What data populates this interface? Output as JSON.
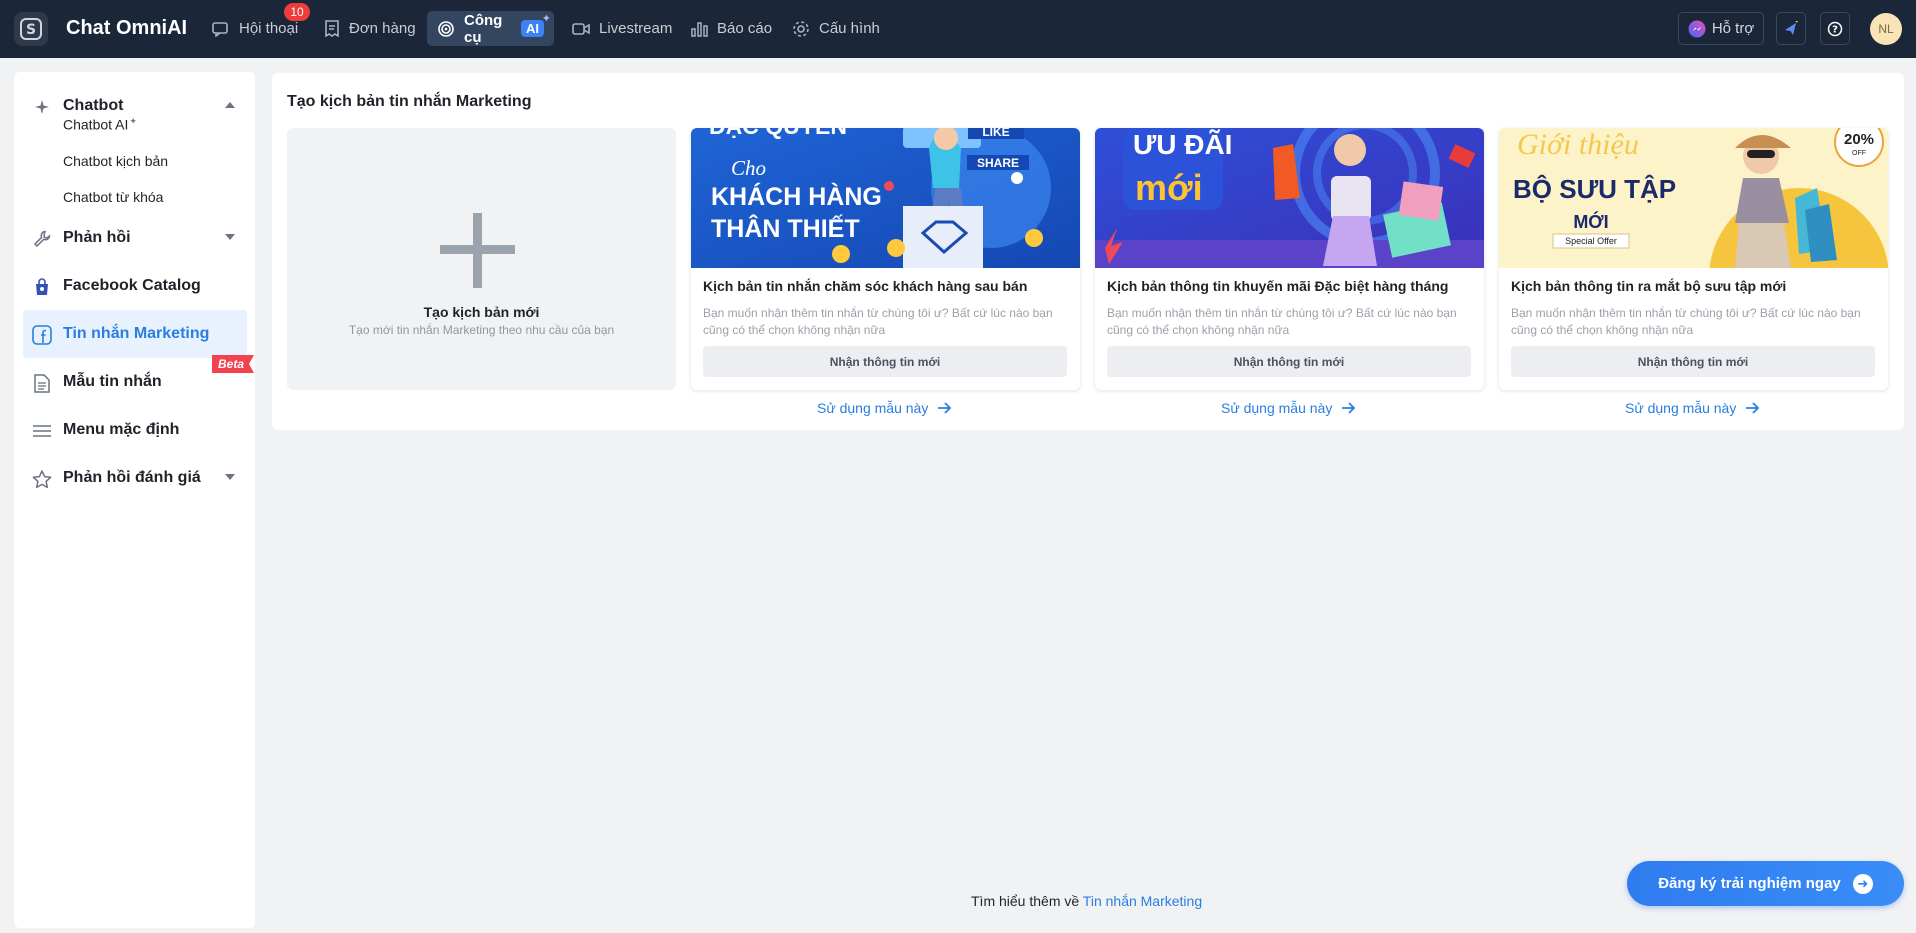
{
  "header": {
    "brand": "Chat OmniAI",
    "nav": [
      {
        "label": "Hội thoại",
        "badge": "10"
      },
      {
        "label": "Đơn hàng"
      },
      {
        "label": "Công cụ",
        "ai": "AI",
        "active": true
      },
      {
        "label": "Livestream"
      },
      {
        "label": "Báo cáo"
      },
      {
        "label": "Cấu hình"
      }
    ],
    "support_label": "Hỗ trợ",
    "avatar_initials": "NL"
  },
  "sidebar": {
    "sections": [
      {
        "label": "Chatbot",
        "icon": "sparkle-icon",
        "expanded": true,
        "children": [
          {
            "label": "Chatbot AI",
            "suffix": "✨"
          },
          {
            "label": "Chatbot kịch bản"
          },
          {
            "label": "Chatbot từ khóa"
          }
        ]
      },
      {
        "label": "Phản hồi",
        "icon": "wrench-icon"
      },
      {
        "label": "Facebook Catalog",
        "icon": "bag-icon"
      },
      {
        "label": "Tin nhắn Marketing",
        "icon": "facebook-icon",
        "active": true,
        "badge": "Beta"
      },
      {
        "label": "Mẫu tin nhắn",
        "icon": "document-icon"
      },
      {
        "label": "Menu mặc định",
        "icon": "menu-icon"
      },
      {
        "label": "Phản hồi đánh giá",
        "icon": "star-icon"
      }
    ]
  },
  "main": {
    "title": "Tạo kịch bản tin nhắn Marketing",
    "new_card": {
      "title": "Tạo kịch bản mới",
      "subtitle": "Tạo mới tin nhắn Marketing theo nhu cầu của bạn"
    },
    "templates": [
      {
        "banner_lines": [
          "ĐẶC QUYỀN",
          "Cho",
          "KHÁCH HÀNG",
          "THÂN THIẾT"
        ],
        "banner_tags": [
          "LIKE",
          "SHARE"
        ],
        "title": "Kịch bản tin nhắn chăm sóc khách hàng sau bán",
        "desc": "Bạn muốn nhận thêm tin nhắn từ chúng tôi ư? Bất cứ lúc nào bạn cũng có thể chọn không nhận nữa",
        "button": "Nhận thông tin mới",
        "link": "Sử dụng mẫu này"
      },
      {
        "banner_lines": [
          "ƯU ĐÃI",
          "mới"
        ],
        "title": "Kịch bản thông tin khuyến mãi Đặc biệt hàng tháng",
        "desc": "Bạn muốn nhận thêm tin nhắn từ chúng tôi ư? Bất cứ lúc nào bạn cũng có thể chọn không nhận nữa",
        "button": "Nhận thông tin mới",
        "link": "Sử dụng mẫu này"
      },
      {
        "banner_lines": [
          "Giới thiệu",
          "BỘ SƯU TẬP",
          "MỚI",
          "Special Offer"
        ],
        "banner_tags": [
          "20%",
          "OFF"
        ],
        "title": "Kịch bản thông tin ra mắt bộ sưu tập mới",
        "desc": "Bạn muốn nhận thêm tin nhắn từ chúng tôi ư? Bất cứ lúc nào bạn cũng có thể chọn không nhận nữa",
        "button": "Nhận thông tin mới",
        "link": "Sử dụng mẫu này"
      }
    ]
  },
  "footer": {
    "learn_prefix": "Tìm hiểu thêm về",
    "learn_link": "Tin nhắn Marketing",
    "cta": "Đăng ký trải nghiệm ngay"
  },
  "colors": {
    "topbar": "#1b2638",
    "accent": "#2a7de1",
    "badge": "#ef3b3b"
  }
}
